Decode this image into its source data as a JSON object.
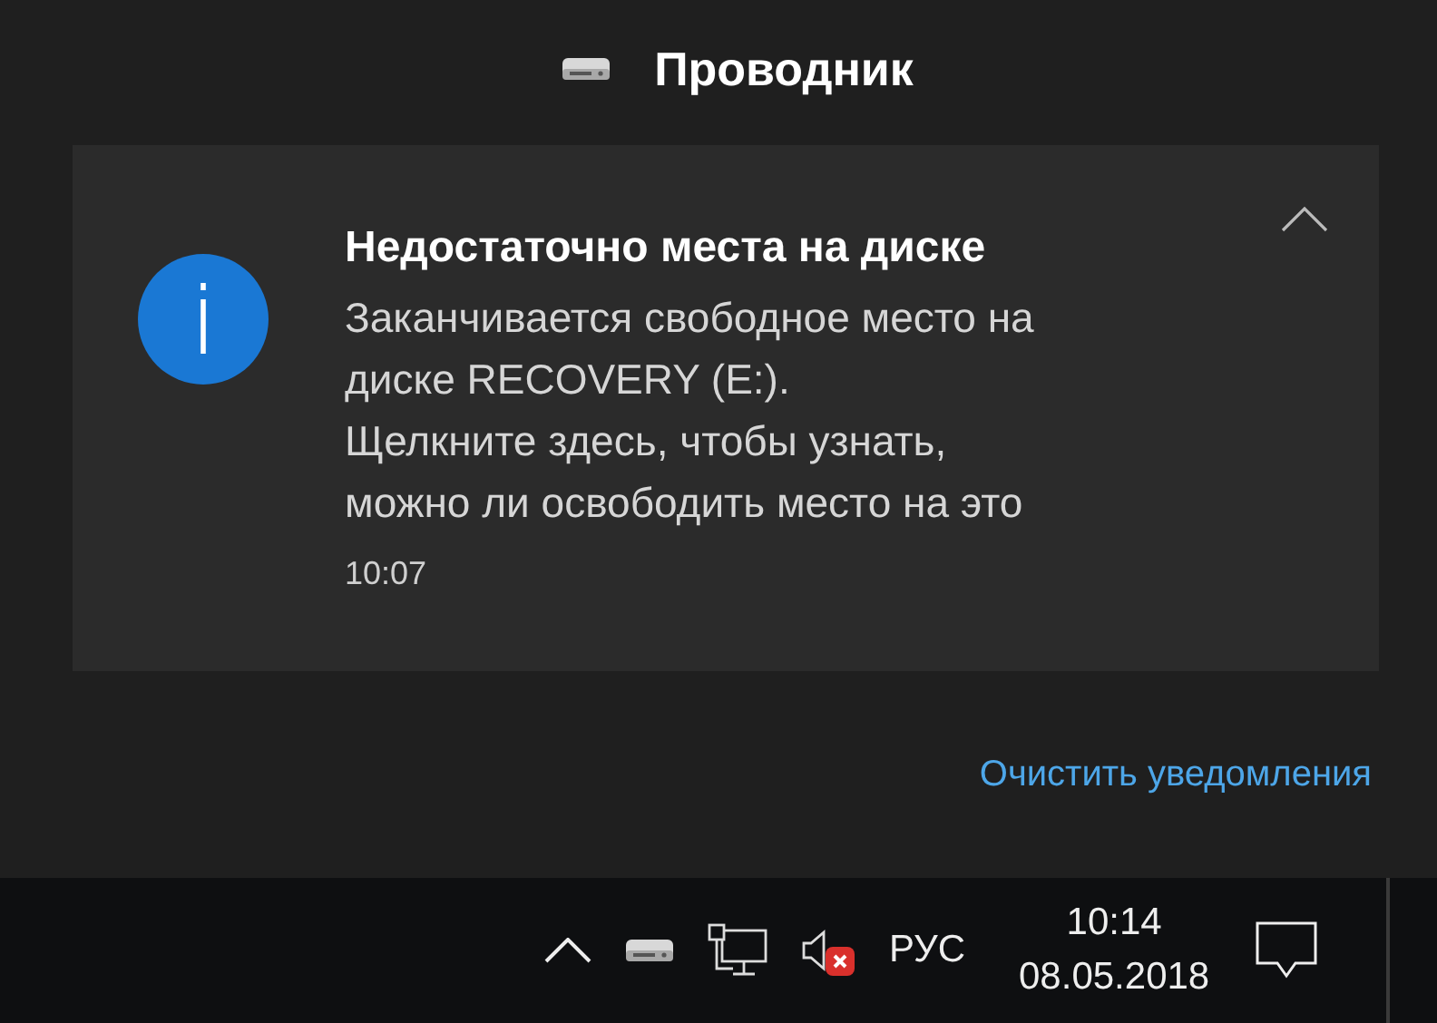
{
  "header": {
    "app_name": "Проводник"
  },
  "notification": {
    "title": "Недостаточно места на диске",
    "body_lines": [
      "Заканчивается свободное место на",
      "диске RECOVERY (E:).",
      "Щелкните здесь, чтобы узнать,",
      "можно ли освободить место на это"
    ],
    "time": "10:07"
  },
  "clear_link": "Очистить уведомления",
  "taskbar": {
    "volume_muted": true,
    "language": "РУС",
    "time": "10:14",
    "date": "08.05.2018"
  }
}
